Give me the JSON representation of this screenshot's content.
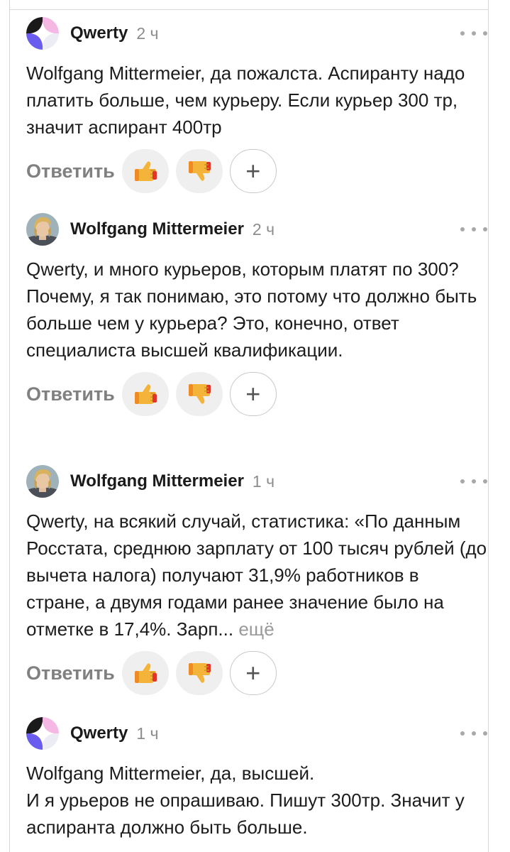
{
  "colors": {
    "text": "#1c1c1c",
    "muted": "#8c8c8c",
    "reaction_bg": "#efefef",
    "qwerty_avatar": [
      "#1a1a1a",
      "#f5b3e0",
      "#6a5cf0",
      "#e8e8f5"
    ]
  },
  "comments": [
    {
      "author": "Qwerty",
      "time": "2 ч",
      "avatar": "qwerty-logo",
      "lines": [
        "Wolfgang Mittermeier, да пожалста. Аспиранту надо платить больше, чем курьеру. Если курьер 300 тр, значит аспирант 400тр"
      ],
      "reply_label": "Ответить",
      "like_icon": "thumbs-up-icon",
      "dislike_icon": "thumbs-down-icon",
      "add_reaction": "+"
    },
    {
      "author": "Wolfgang Mittermeier",
      "time": "2 ч",
      "avatar": "portrait",
      "lines": [
        "Qwerty, и много курьеров, которым платят по 300?",
        "Почему, я так понимаю, это потому что должно быть больше чем у курьера? Это, конечно, ответ специалиста высшей квалификации."
      ],
      "reply_label": "Ответить",
      "like_icon": "thumbs-up-icon",
      "dislike_icon": "thumbs-down-icon",
      "add_reaction": "+"
    },
    {
      "author": "Wolfgang Mittermeier",
      "time": "1 ч",
      "avatar": "portrait",
      "lines": [
        "Qwerty, на всякий случай, статистика: «По данным Росстата, среднюю зарплату от 100 тысяч рублей (до вычета налога) получают 31,9% работников в стране, а двумя годами ранее значение было на отметке в 17,4%. Зарп..."
      ],
      "more_label": "ещё",
      "reply_label": "Ответить",
      "like_icon": "thumbs-up-icon",
      "dislike_icon": "thumbs-down-icon",
      "add_reaction": "+"
    },
    {
      "author": "Qwerty",
      "time": "1 ч",
      "avatar": "qwerty-logo",
      "lines": [
        "Wolfgang Mittermeier, да, высшей.",
        "И я урьеров не опрашиваю. Пишут 300тр. Значит у аспиранта должно быть больше."
      ]
    }
  ]
}
